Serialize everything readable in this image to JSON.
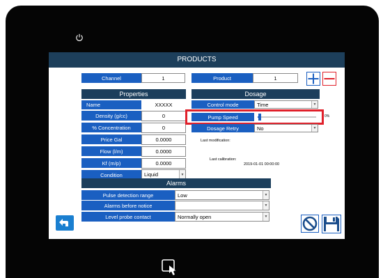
{
  "title": "PRODUCTS",
  "channel": {
    "label": "Channel",
    "value": "1"
  },
  "product": {
    "label": "Product",
    "value": "1"
  },
  "properties": {
    "header": "Properties",
    "rows": [
      {
        "label": "Name",
        "value": "XXXXX"
      },
      {
        "label": "Density (g/cc)",
        "value": "0"
      },
      {
        "label": "% Concentration",
        "value": "0"
      },
      {
        "label": "Price Gal",
        "value": "0.0000"
      },
      {
        "label": "Flow (l/m)",
        "value": "0.0000"
      },
      {
        "label": "Kf (m/p)",
        "value": "0.0000"
      },
      {
        "label": "Condition",
        "value": "Liquid"
      }
    ]
  },
  "dosage": {
    "header": "Dosage",
    "control_mode_label": "Control mode",
    "control_mode_value": "Time",
    "pump_speed_label": "Pump Speed",
    "pump_speed_value": "0%",
    "pump_speed_level": 0.04,
    "dosage_retry_label": "Dosage Retry",
    "dosage_retry_value": "No",
    "last_modification_label": "Last modification:",
    "last_calibration_label": "Last calibration:",
    "last_calibration_value": "2019-01-01 00:00:00"
  },
  "alarms": {
    "header": "Alarms",
    "rows": [
      {
        "label": "Pulse detection range",
        "value": "Low"
      },
      {
        "label": "Alarms before notice",
        "value": ""
      },
      {
        "label": "Level probe contact",
        "value": "Normally open"
      }
    ]
  },
  "colors": {
    "accent": "#1a5fc1",
    "header": "#1b3e5c",
    "highlight": "#e0202a"
  },
  "icons": {
    "power": "power-icon",
    "touch": "touch-icon",
    "back": "back-arrow-icon",
    "cancel": "cancel-icon",
    "save": "save-icon",
    "plus": "plus-icon",
    "minus": "minus-icon"
  }
}
